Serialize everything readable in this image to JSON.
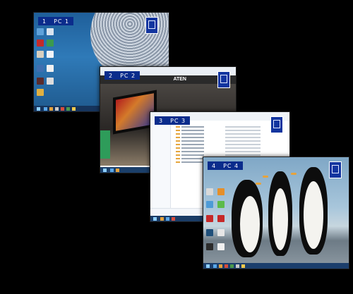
{
  "screens": [
    {
      "id": "1",
      "name": "PC 1"
    },
    {
      "id": "2",
      "name": "PC 2",
      "brand": "ATEN"
    },
    {
      "id": "3",
      "name": "PC 3"
    },
    {
      "id": "4",
      "name": "PC 4"
    }
  ],
  "icons": {
    "monitor": "monitor-icon",
    "desktop": "desktop-shortcut-icon",
    "taskbar": "taskbar-app-icon"
  },
  "colors": {
    "background": "#000000",
    "label_bg": "#0b2c8c",
    "label_text": "#ffffff"
  }
}
